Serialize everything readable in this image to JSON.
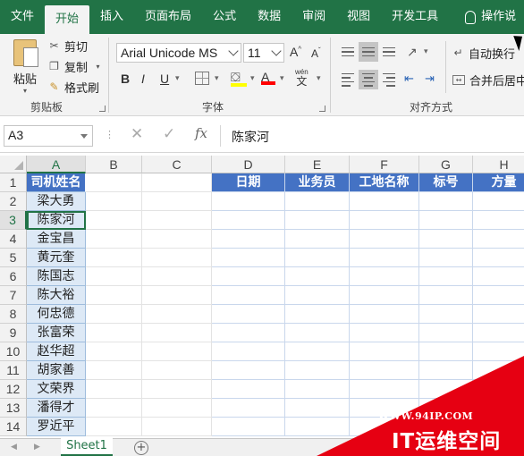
{
  "ribbon_tabs": [
    {
      "label": "文件",
      "active": false
    },
    {
      "label": "开始",
      "active": true
    },
    {
      "label": "插入",
      "active": false
    },
    {
      "label": "页面布局",
      "active": false
    },
    {
      "label": "公式",
      "active": false
    },
    {
      "label": "数据",
      "active": false
    },
    {
      "label": "审阅",
      "active": false
    },
    {
      "label": "视图",
      "active": false
    },
    {
      "label": "开发工具",
      "active": false
    }
  ],
  "tell_me": "操作说",
  "clipboard": {
    "paste": "粘贴",
    "cut": "剪切",
    "copy": "复制",
    "format_painter": "格式刷",
    "group_label": "剪贴板"
  },
  "font": {
    "name": "Arial Unicode MS",
    "size": "11",
    "bold": "B",
    "italic": "I",
    "underline": "U",
    "grow": "A",
    "shrink": "A",
    "color_letter": "A",
    "phonetic": "wén",
    "phonetic_char": "文",
    "group_label": "字体"
  },
  "alignment": {
    "wrap_text": "自动换行",
    "merge_center": "合并后居中",
    "group_label": "对齐方式"
  },
  "formula_bar": {
    "name_box": "A3",
    "fx": "fx",
    "content": "陈家河"
  },
  "columns": [
    "A",
    "B",
    "C",
    "D",
    "E",
    "F",
    "G",
    "H"
  ],
  "rows": [
    "1",
    "2",
    "3",
    "4",
    "5",
    "6",
    "7",
    "8",
    "9",
    "10",
    "11",
    "12",
    "13",
    "14"
  ],
  "active_cell": "A3",
  "column_a": [
    "司机姓名",
    "梁大勇",
    "陈家河",
    "金宝昌",
    "黄元奎",
    "陈国志",
    "陈大裕",
    "何忠德",
    "张富荣",
    "赵华超",
    "胡家善",
    "文荣界",
    "潘得才",
    "罗近平"
  ],
  "table_headers": [
    "日期",
    "业务员",
    "工地名称",
    "标号",
    "方量"
  ],
  "sheet_tab": "Sheet1",
  "watermark": {
    "url": "WWW.94IP.COM",
    "name": "IT运维空间"
  },
  "colors": {
    "ribbon_green": "#217346",
    "header_blue": "#4472c4",
    "column_a_fill": "#dde9f6",
    "watermark_red": "#e60012"
  }
}
